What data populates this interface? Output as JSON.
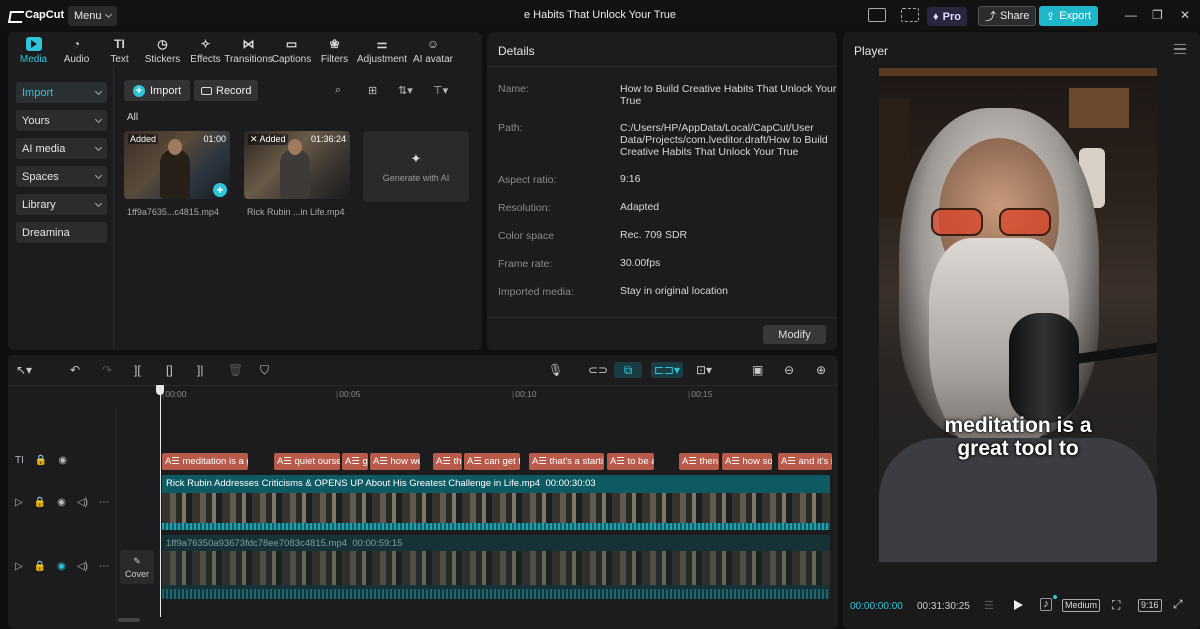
{
  "app": {
    "brand": "CapCut",
    "menu_label": "Menu",
    "window_title": "e Habits That Unlock Your True",
    "pro_label": "Pro",
    "share_label": "Share",
    "export_label": "Export",
    "accent_color": "#2ec5d8"
  },
  "tools": [
    {
      "label": "Media",
      "icon": "media-icon",
      "active": true
    },
    {
      "label": "Audio",
      "icon": "audio-icon"
    },
    {
      "label": "Text",
      "icon": "text-icon"
    },
    {
      "label": "Stickers",
      "icon": "stickers-icon"
    },
    {
      "label": "Effects",
      "icon": "effects-icon"
    },
    {
      "label": "Transitions",
      "icon": "transitions-icon"
    },
    {
      "label": "Captions",
      "icon": "captions-icon"
    },
    {
      "label": "Filters",
      "icon": "filters-icon"
    },
    {
      "label": "Adjustment",
      "icon": "adjustment-icon"
    },
    {
      "label": "AI avatar",
      "icon": "ai-avatar-icon"
    }
  ],
  "media": {
    "sidebar": [
      "Import",
      "Yours",
      "AI media",
      "Spaces",
      "Library",
      "Dreamina"
    ],
    "import_label": "Import",
    "record_label": "Record",
    "all_label": "All",
    "items": [
      {
        "badge": "Added",
        "duration": "01:00",
        "name": "1ff9a7635...c4815.mp4"
      },
      {
        "badge": "Added",
        "duration": "01:36:24",
        "name": "Rick Rubin ...in Life.mp4"
      }
    ],
    "generate_ai_label": "Generate with AI"
  },
  "details": {
    "title": "Details",
    "rows": [
      {
        "label": "Name:",
        "value": "How to Build Creative Habits That Unlock Your True"
      },
      {
        "label": "Path:",
        "value": "C:/Users/HP/AppData/Local/CapCut/User Data/Projects/com.lveditor.draft/How to Build Creative Habits That Unlock Your True"
      },
      {
        "label": "Aspect ratio:",
        "value": "9:16"
      },
      {
        "label": "Resolution:",
        "value": "Adapted"
      },
      {
        "label": "Color space",
        "value": "Rec. 709 SDR"
      },
      {
        "label": "Frame rate:",
        "value": "30.00fps"
      },
      {
        "label": "Imported media:",
        "value": "Stay in original location"
      }
    ],
    "modify_label": "Modify"
  },
  "player": {
    "title": "Player",
    "caption_line1": "meditation is a",
    "caption_line2": "great tool to",
    "current_time": "00:00:00:00",
    "total_time": "00:31:30:25",
    "quality": "Medium",
    "ratio": "9:16"
  },
  "timeline": {
    "ruler": [
      "00:00",
      "00:05",
      "00:10",
      "00:15"
    ],
    "text_clips": [
      "meditation is a g",
      "quiet ourse",
      "ge",
      "how we",
      "th",
      "can get t",
      "that's a starti",
      "to be a",
      "then",
      "how so",
      "and it's in"
    ],
    "main_clip_label": "Rick Rubin Addresses Criticisms & OPENS UP About His Greatest Challenge in Life.mp4",
    "main_clip_duration": "00:00:30:03",
    "sub_clip_label": "1ff9a76350a93673fdc78ee7083c4815.mp4",
    "sub_clip_duration": "00:00:59:15",
    "cover_label": "Cover"
  }
}
